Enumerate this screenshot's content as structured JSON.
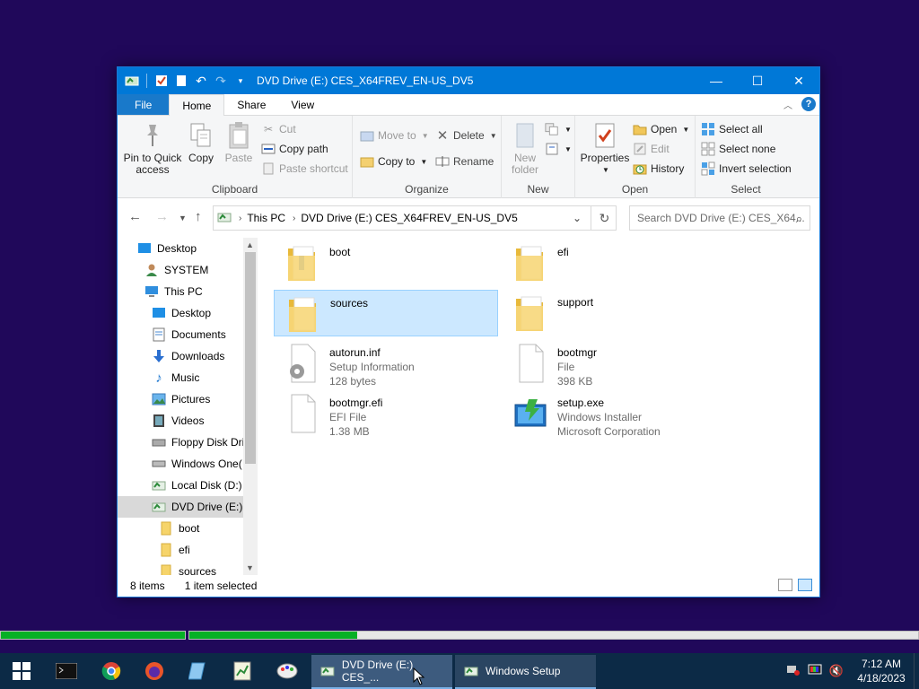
{
  "window": {
    "title": "DVD Drive (E:) CES_X64FREV_EN-US_DV5",
    "controls": {
      "minimize": "—",
      "maximize": "☐",
      "close": "✕"
    }
  },
  "ribbon_tabs": [
    "File",
    "Home",
    "Share",
    "View"
  ],
  "ribbon": {
    "clipboard": {
      "label": "Clipboard",
      "pin": "Pin to Quick access",
      "pin_line1": "Pin to Quick",
      "pin_line2": "access",
      "copy": "Copy",
      "paste": "Paste",
      "cut": "Cut",
      "copy_path": "Copy path",
      "paste_shortcut": "Paste shortcut"
    },
    "organize": {
      "label": "Organize",
      "move_to": "Move to",
      "copy_to": "Copy to",
      "delete": "Delete",
      "rename": "Rename"
    },
    "new": {
      "label": "New",
      "new_folder_line1": "New",
      "new_folder_line2": "folder"
    },
    "open": {
      "label": "Open",
      "properties": "Properties",
      "open": "Open",
      "edit": "Edit",
      "history": "History"
    },
    "select": {
      "label": "Select",
      "select_all": "Select all",
      "select_none": "Select none",
      "invert": "Invert selection"
    }
  },
  "address": {
    "crumbs": [
      "This PC",
      "DVD Drive (E:) CES_X64FREV_EN-US_DV5"
    ],
    "search_placeholder": "Search DVD Drive (E:) CES_X64..."
  },
  "nav_items": [
    {
      "label": "Desktop",
      "icon": "desktop-icon"
    },
    {
      "label": "SYSTEM",
      "icon": "user-icon"
    },
    {
      "label": "This PC",
      "icon": "computer-icon"
    },
    {
      "label": "Desktop",
      "icon": "desktop-icon"
    },
    {
      "label": "Documents",
      "icon": "documents-icon"
    },
    {
      "label": "Downloads",
      "icon": "downloads-icon"
    },
    {
      "label": "Music",
      "icon": "music-icon"
    },
    {
      "label": "Pictures",
      "icon": "pictures-icon"
    },
    {
      "label": "Videos",
      "icon": "videos-icon"
    },
    {
      "label": "Floppy Disk Dri",
      "icon": "floppy-icon"
    },
    {
      "label": "Windows One(",
      "icon": "drive-icon"
    },
    {
      "label": "Local Disk (D:)",
      "icon": "drive-icon"
    },
    {
      "label": "DVD Drive (E:) (",
      "icon": "dvd-icon"
    },
    {
      "label": "boot",
      "icon": "folder-icon"
    },
    {
      "label": "efi",
      "icon": "folder-icon"
    },
    {
      "label": "sources",
      "icon": "folder-icon"
    }
  ],
  "files": [
    {
      "name": "boot",
      "line2": "",
      "line3": "",
      "icon": "folder-icon"
    },
    {
      "name": "efi",
      "line2": "",
      "line3": "",
      "icon": "folder-icon"
    },
    {
      "name": "sources",
      "line2": "",
      "line3": "",
      "icon": "folder-icon"
    },
    {
      "name": "support",
      "line2": "",
      "line3": "",
      "icon": "folder-icon"
    },
    {
      "name": "autorun.inf",
      "line2": "Setup Information",
      "line3": "128 bytes",
      "icon": "settings-file-icon"
    },
    {
      "name": "bootmgr",
      "line2": "File",
      "line3": "398 KB",
      "icon": "file-icon"
    },
    {
      "name": "bootmgr.efi",
      "line2": "EFI File",
      "line3": "1.38 MB",
      "icon": "file-icon"
    },
    {
      "name": "setup.exe",
      "line2": "Windows Installer",
      "line3": "Microsoft Corporation",
      "icon": "installer-icon"
    }
  ],
  "status": {
    "count": "8 items",
    "selected": "1 item selected"
  },
  "progress": [
    {
      "fraction": 1.0
    },
    {
      "fraction": 0.23
    }
  ],
  "taskbar": {
    "apps": [
      {
        "label": "DVD Drive (E:) CES_...",
        "icon": "explorer-icon"
      },
      {
        "label": "Windows Setup",
        "icon": "setup-icon"
      }
    ],
    "time": "7:12 AM",
    "date": "4/18/2023"
  },
  "colors": {
    "accent": "#0078d7",
    "desktop": "#20085a",
    "taskbar": "#0c2a46",
    "selection": "#cce8ff",
    "progress": "#06b025"
  }
}
